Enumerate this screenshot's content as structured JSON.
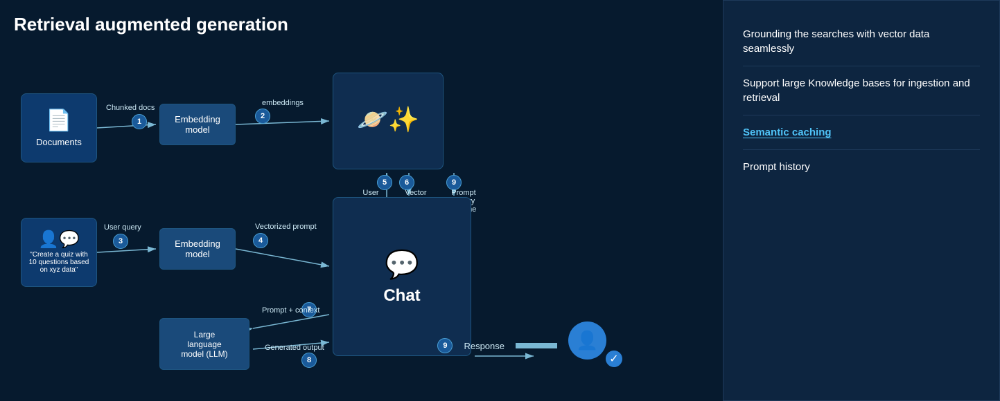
{
  "title": "Retrieval augmented generation",
  "sidebar": {
    "items": [
      {
        "id": "grounding",
        "text": "Grounding the searches with vector data seamlessly",
        "highlight": false
      },
      {
        "id": "knowledge",
        "text": "Support large Knowledge bases for ingestion and retrieval",
        "highlight": false
      },
      {
        "id": "caching",
        "text": "Semantic caching",
        "highlight": true
      },
      {
        "id": "history",
        "text": "Prompt history",
        "highlight": false
      }
    ]
  },
  "diagram": {
    "nodes": {
      "documents": "Documents",
      "embed1": "Embedding\nmodel",
      "embed2": "Embedding\nmodel",
      "llm": "Large\nlanguage\nmodel (LLM)",
      "chat": "Chat",
      "user_query_box": "\"Create a quiz with 10 questions based on xyz data\""
    },
    "labels": {
      "chunked": "Chunked docs",
      "embeddings": "embeddings",
      "user_query": "User query",
      "vectorized": "Vectorized prompt",
      "vector_search": "Vector\nsearch",
      "user_query_arrow": "User\nquery",
      "prompt_history": "Prompt\nhistory\n&cache",
      "prompt_context": "Prompt + context",
      "generated": "Generated output",
      "response": "Response"
    },
    "numbers": [
      "1",
      "2",
      "3",
      "4",
      "5",
      "6",
      "7",
      "8",
      "9"
    ]
  }
}
